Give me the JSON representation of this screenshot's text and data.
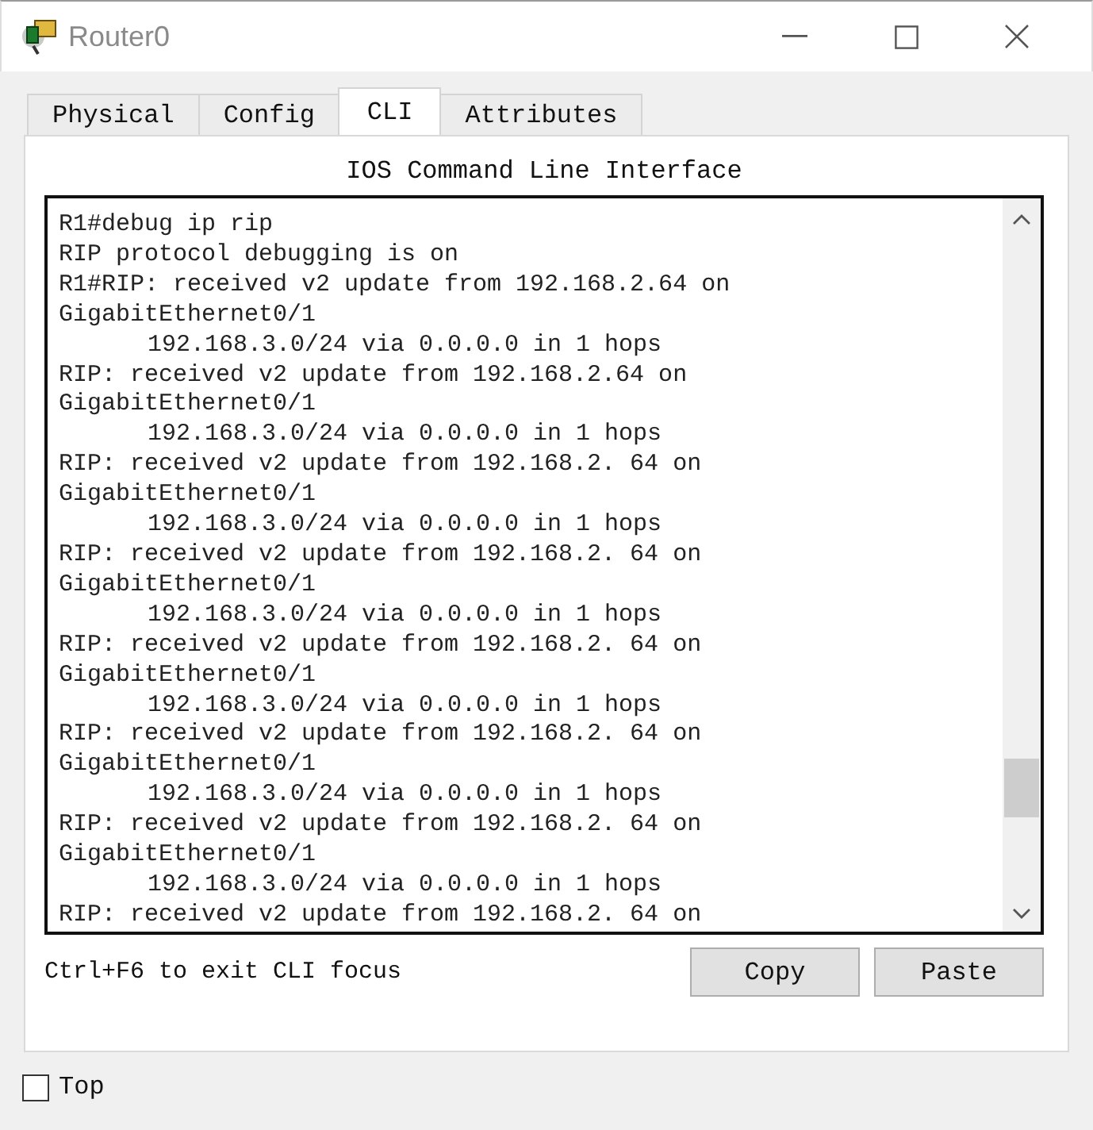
{
  "window": {
    "title": "Router0"
  },
  "tabs": [
    {
      "label": "Physical",
      "selected": false
    },
    {
      "label": "Config",
      "selected": false
    },
    {
      "label": "CLI",
      "selected": true
    },
    {
      "label": "Attributes",
      "selected": false
    }
  ],
  "cli": {
    "heading": "IOS Command Line Interface",
    "lines": [
      {
        "text": "R1#debug ip rip",
        "indented": false
      },
      {
        "text": "RIP protocol debugging is on",
        "indented": false
      },
      {
        "text": "R1#RIP: received v2 update from 192.168.2.64 on",
        "indented": false
      },
      {
        "text": "GigabitEthernet0/1",
        "indented": false
      },
      {
        "text": "192.168.3.0/24 via 0.0.0.0 in 1 hops",
        "indented": true
      },
      {
        "text": "RIP: received v2 update from 192.168.2.64 on",
        "indented": false
      },
      {
        "text": "GigabitEthernet0/1",
        "indented": false
      },
      {
        "text": "192.168.3.0/24 via 0.0.0.0 in 1 hops",
        "indented": true
      },
      {
        "text": "RIP: received v2 update from 192.168.2. 64 on",
        "indented": false
      },
      {
        "text": "GigabitEthernet0/1",
        "indented": false
      },
      {
        "text": "192.168.3.0/24 via 0.0.0.0 in 1 hops",
        "indented": true
      },
      {
        "text": "RIP: received v2 update from 192.168.2. 64 on",
        "indented": false
      },
      {
        "text": "GigabitEthernet0/1",
        "indented": false
      },
      {
        "text": "192.168.3.0/24 via 0.0.0.0 in 1 hops",
        "indented": true
      },
      {
        "text": "RIP: received v2 update from 192.168.2. 64 on",
        "indented": false
      },
      {
        "text": "GigabitEthernet0/1",
        "indented": false
      },
      {
        "text": "192.168.3.0/24 via 0.0.0.0 in 1 hops",
        "indented": true
      },
      {
        "text": "RIP: received v2 update from 192.168.2. 64 on",
        "indented": false
      },
      {
        "text": "GigabitEthernet0/1",
        "indented": false
      },
      {
        "text": "192.168.3.0/24 via 0.0.0.0 in 1 hops",
        "indented": true
      },
      {
        "text": "RIP: received v2 update from 192.168.2. 64 on",
        "indented": false
      },
      {
        "text": "GigabitEthernet0/1",
        "indented": false
      },
      {
        "text": "192.168.3.0/24 via 0.0.0.0 in 1 hops",
        "indented": true
      },
      {
        "text": "RIP: received v2 update from 192.168.2. 64 on",
        "indented": false
      }
    ],
    "hint": "Ctrl+F6 to exit CLI focus",
    "buttons": [
      "Copy",
      "Paste"
    ]
  },
  "top_checkbox": {
    "label": "Top",
    "checked": false
  }
}
